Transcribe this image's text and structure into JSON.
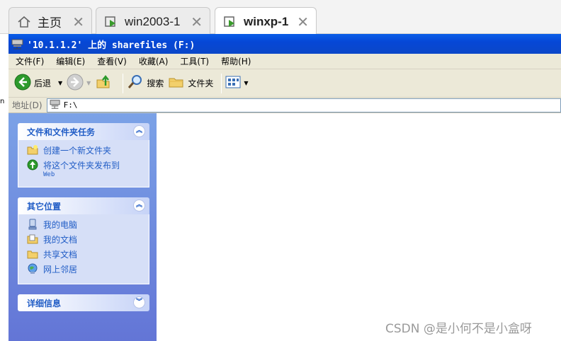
{
  "vm_tabs": [
    {
      "label": "主页",
      "icon": "home-icon"
    },
    {
      "label": "win2003-1",
      "icon": "vm-icon"
    },
    {
      "label": "winxp-1",
      "icon": "vm-icon",
      "active": true
    }
  ],
  "window": {
    "title": "'10.1.1.2' 上的 sharefiles (F:)"
  },
  "menu": [
    "文件(F)",
    "编辑(E)",
    "查看(V)",
    "收藏(A)",
    "工具(T)",
    "帮助(H)"
  ],
  "toolbar": {
    "back_label": "后退",
    "search_label": "搜索",
    "folders_label": "文件夹"
  },
  "address": {
    "label": "地址(D)",
    "value": "F:\\"
  },
  "taskpane": {
    "file_tasks": {
      "title": "文件和文件夹任务",
      "items": [
        "创建一个新文件夹",
        "将这个文件夹发布到"
      ],
      "web_suffix": "Web"
    },
    "other_places": {
      "title": "其它位置",
      "items": [
        "我的电脑",
        "我的文档",
        "共享文档",
        "网上邻居"
      ]
    },
    "details": {
      "title": "详细信息"
    }
  },
  "watermark": "CSDN @是小何不是小盒呀",
  "colors": {
    "titlebar": "#0a5ee8",
    "link": "#215dc6",
    "taskpane_bg": "#7ba2e7"
  }
}
